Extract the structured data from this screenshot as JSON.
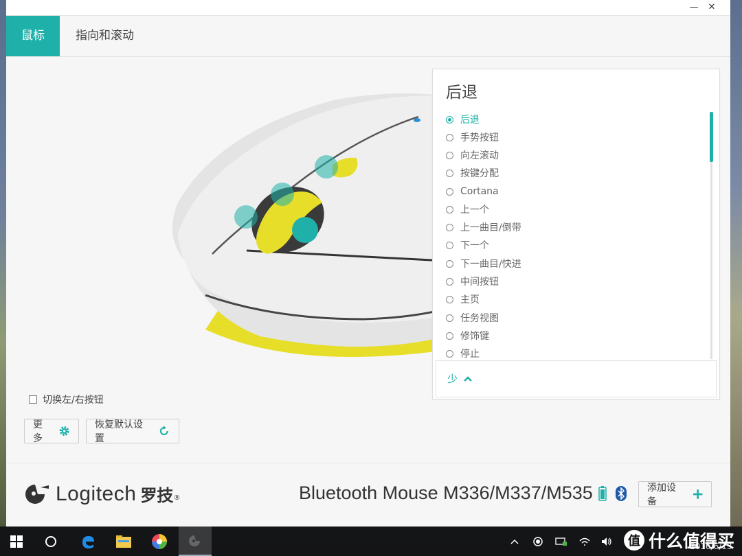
{
  "window": {
    "minimize_glyph": "—",
    "close_glyph": "✕"
  },
  "tabs": [
    {
      "label": "鼠标"
    },
    {
      "label": "指向和滚动"
    }
  ],
  "panel": {
    "title": "后退",
    "options": [
      "后退",
      "手势按钮",
      "向左滚动",
      "按键分配",
      "Cortana",
      "上一个",
      "上一曲目/倒带",
      "下一个",
      "下一曲目/快进",
      "中间按钮",
      "主页",
      "任务视图",
      "修饰键",
      "停止"
    ],
    "selected_index": 0,
    "less_label": "少"
  },
  "swap_buttons_label": "切换左/右按钮",
  "more_button_label": "更多",
  "reset_button_label": "恢复默认设置",
  "footer": {
    "brand_word": "Logitech",
    "brand_cn": "罗技",
    "brand_mark": "®",
    "device_name": "Bluetooth Mouse M336/M337/M535",
    "add_device_label": "添加设备"
  },
  "taskbar": {
    "date": "2016/6/13"
  },
  "watermark": {
    "text": "什么值得买",
    "badge": "值"
  },
  "colors": {
    "accent": "#1fb1a9",
    "mouse_yellow": "#e7de2a"
  },
  "icons": [
    "gear-icon",
    "refresh-icon",
    "battery-icon",
    "bluetooth-icon",
    "plus-icon",
    "chevron-up-icon",
    "windows-start-icon",
    "cortana-circle-icon",
    "edge-icon",
    "file-explorer-icon",
    "photos-icon",
    "logitech-options-icon",
    "chevron-up-tray-icon",
    "record-icon",
    "network-icon",
    "wifi-icon",
    "volume-icon"
  ]
}
